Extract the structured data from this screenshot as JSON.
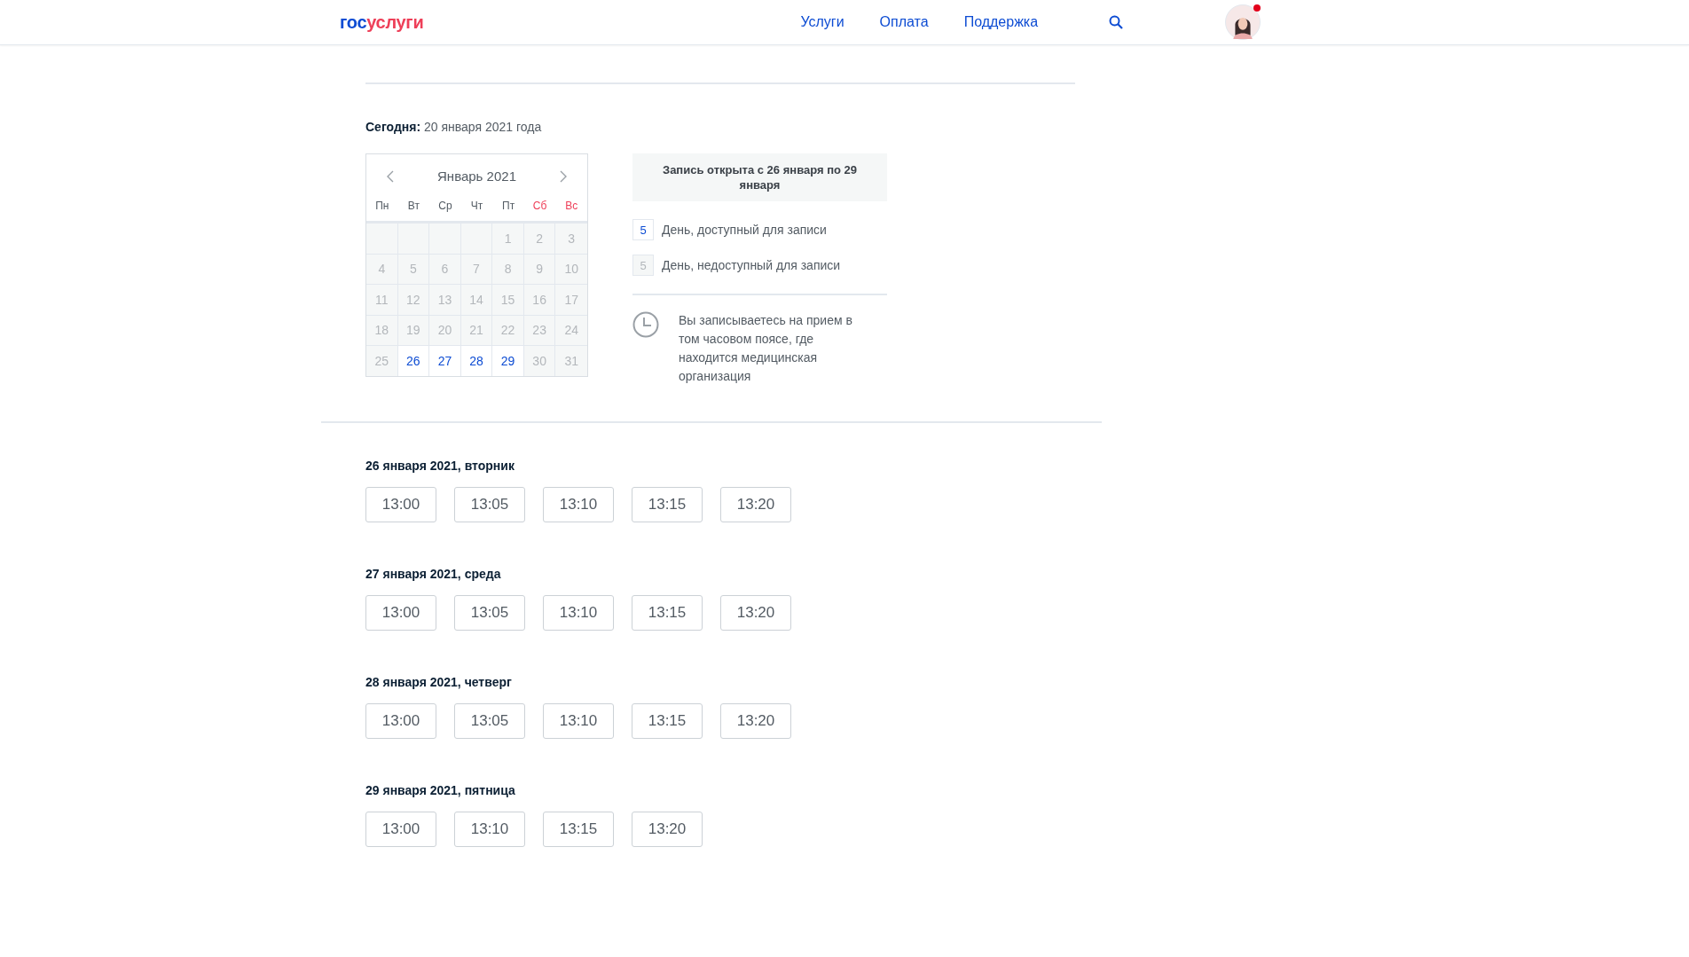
{
  "header": {
    "logo": [
      {
        "text": "гос",
        "color": "#0d4cd3"
      },
      {
        "text": "услуги",
        "color": "#ee3f58"
      }
    ],
    "nav": [
      "Услуги",
      "Оплата",
      "Поддержка"
    ]
  },
  "today": {
    "label": "Сегодня:",
    "value": " 20 января 2021 года"
  },
  "calendar": {
    "month": "Январь 2021",
    "weekdays": [
      {
        "text": "Пн",
        "weekend": false
      },
      {
        "text": "Вт",
        "weekend": false
      },
      {
        "text": "Ср",
        "weekend": false
      },
      {
        "text": "Чт",
        "weekend": false
      },
      {
        "text": "Пт",
        "weekend": false
      },
      {
        "text": "Сб",
        "weekend": true
      },
      {
        "text": "Вс",
        "weekend": true
      }
    ],
    "weeks": [
      [
        {
          "kind": "blank"
        },
        {
          "kind": "blank"
        },
        {
          "kind": "blank"
        },
        {
          "kind": "blank"
        },
        {
          "kind": "day",
          "day": "1",
          "available": false
        },
        {
          "kind": "day",
          "day": "2",
          "available": false
        },
        {
          "kind": "day",
          "day": "3",
          "available": false
        }
      ],
      [
        {
          "kind": "day",
          "day": "4",
          "available": false
        },
        {
          "kind": "day",
          "day": "5",
          "available": false
        },
        {
          "kind": "day",
          "day": "6",
          "available": false
        },
        {
          "kind": "day",
          "day": "7",
          "available": false
        },
        {
          "kind": "day",
          "day": "8",
          "available": false
        },
        {
          "kind": "day",
          "day": "9",
          "available": false
        },
        {
          "kind": "day",
          "day": "10",
          "available": false
        }
      ],
      [
        {
          "kind": "day",
          "day": "11",
          "available": false
        },
        {
          "kind": "day",
          "day": "12",
          "available": false
        },
        {
          "kind": "day",
          "day": "13",
          "available": false
        },
        {
          "kind": "day",
          "day": "14",
          "available": false
        },
        {
          "kind": "day",
          "day": "15",
          "available": false
        },
        {
          "kind": "day",
          "day": "16",
          "available": false
        },
        {
          "kind": "day",
          "day": "17",
          "available": false
        }
      ],
      [
        {
          "kind": "day",
          "day": "18",
          "available": false
        },
        {
          "kind": "day",
          "day": "19",
          "available": false
        },
        {
          "kind": "day",
          "day": "20",
          "available": false
        },
        {
          "kind": "day",
          "day": "21",
          "available": false
        },
        {
          "kind": "day",
          "day": "22",
          "available": false
        },
        {
          "kind": "day",
          "day": "23",
          "available": false
        },
        {
          "kind": "day",
          "day": "24",
          "available": false
        }
      ],
      [
        {
          "kind": "day",
          "day": "25",
          "available": false
        },
        {
          "kind": "day",
          "day": "26",
          "available": true
        },
        {
          "kind": "day",
          "day": "27",
          "available": true
        },
        {
          "kind": "day",
          "day": "28",
          "available": true
        },
        {
          "kind": "day",
          "day": "29",
          "available": true
        },
        {
          "kind": "day",
          "day": "30",
          "available": false
        },
        {
          "kind": "day",
          "day": "31",
          "available": false
        }
      ]
    ]
  },
  "booking_window": "Запись открыта с 26 января по 29 января",
  "legend": [
    {
      "sample": "5",
      "label": "День, доступный для записи",
      "available": true
    },
    {
      "sample": "5",
      "label": "День, недоступный для записи",
      "available": false
    }
  ],
  "timezone_note": "Вы записываетесь на прием в том часовом поясе, где находится медицинская организация",
  "days": [
    {
      "title": "26 января 2021, вторник",
      "slots": [
        "13:00",
        "13:05",
        "13:10",
        "13:15",
        "13:20"
      ]
    },
    {
      "title": "27 января 2021, среда",
      "slots": [
        "13:00",
        "13:05",
        "13:10",
        "13:15",
        "13:20"
      ]
    },
    {
      "title": "28 января 2021, четверг",
      "slots": [
        "13:00",
        "13:05",
        "13:10",
        "13:15",
        "13:20"
      ]
    },
    {
      "title": "29 января 2021, пятница",
      "slots": [
        "13:00",
        "13:10",
        "13:15",
        "13:20"
      ]
    }
  ]
}
